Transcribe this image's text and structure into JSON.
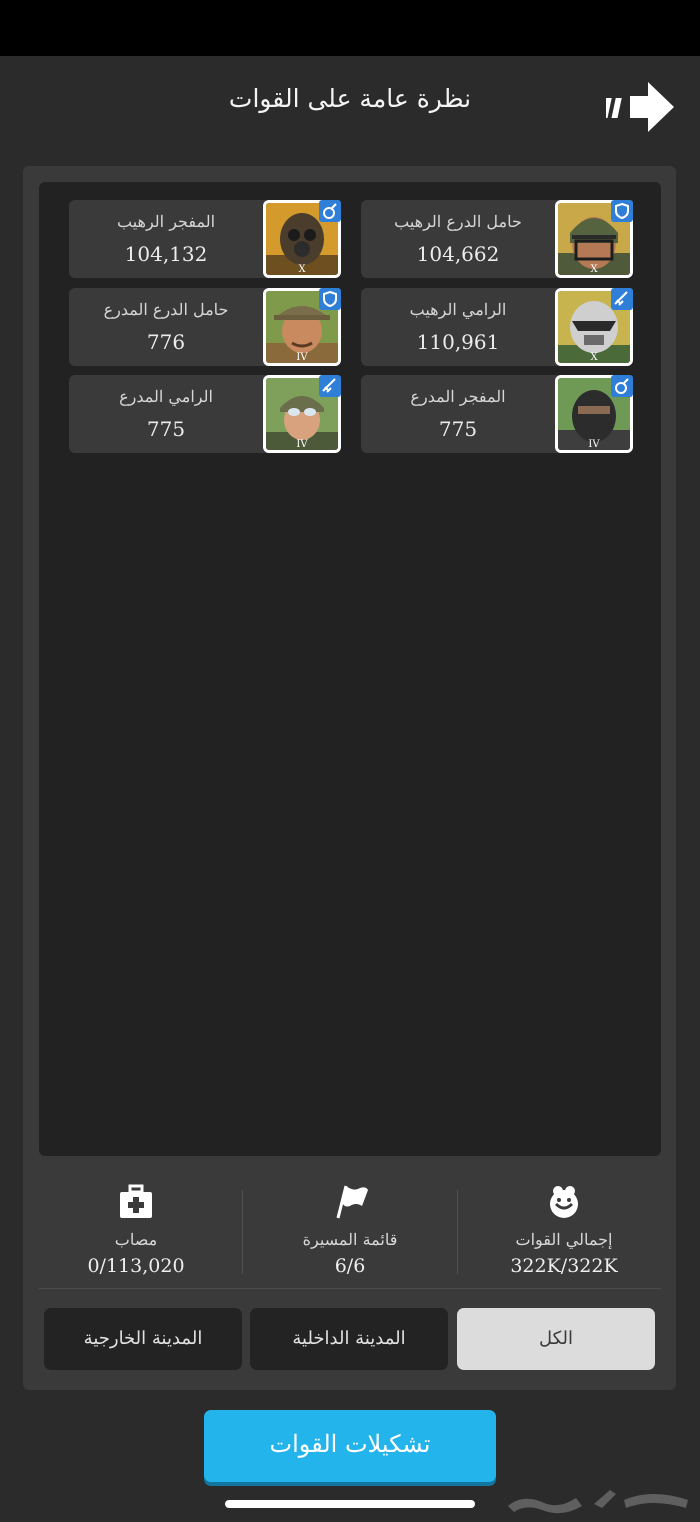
{
  "header": {
    "title": "نظرة عامة على القوات"
  },
  "troops": [
    {
      "name": "حامل الدرع الرهيب",
      "count": "104,662",
      "tier": "X",
      "role_icon": "shield-icon",
      "portrait": "helmet-soldier"
    },
    {
      "name": "المفجر الرهيب",
      "count": "104,132",
      "tier": "X",
      "role_icon": "grenade-icon",
      "portrait": "gasmask-soldier"
    },
    {
      "name": "الرامي الرهيب",
      "count": "110,961",
      "tier": "X",
      "role_icon": "rifle-icon",
      "portrait": "armored-soldier"
    },
    {
      "name": "حامل الدرع المدرع",
      "count": "776",
      "tier": "IV",
      "role_icon": "shield-icon",
      "portrait": "hat-soldier"
    },
    {
      "name": "المفجر المدرع",
      "count": "775",
      "tier": "IV",
      "role_icon": "grenade-icon",
      "portrait": "masked-soldier"
    },
    {
      "name": "الرامي المدرع",
      "count": "775",
      "tier": "IV",
      "role_icon": "rifle-icon",
      "portrait": "goggles-soldier"
    }
  ],
  "stats": {
    "total": {
      "label": "إجمالي القوات",
      "value": "322K/322K",
      "icon": "troops-icon"
    },
    "march": {
      "label": "قائمة المسيرة",
      "value": "6/6",
      "icon": "flag-icon"
    },
    "wounded": {
      "label": "مصاب",
      "value": "0/113,020",
      "icon": "medkit-icon"
    }
  },
  "filters": {
    "all": "الكل",
    "inner_city": "المدينة الداخلية",
    "outer_city": "المدينة الخارجية"
  },
  "formations_button": "تشكيلات القوات",
  "colors": {
    "accent": "#22b4ea",
    "panel": "#3a3a3b",
    "background": "#2b2b2c",
    "badge": "#2f7fd8"
  }
}
